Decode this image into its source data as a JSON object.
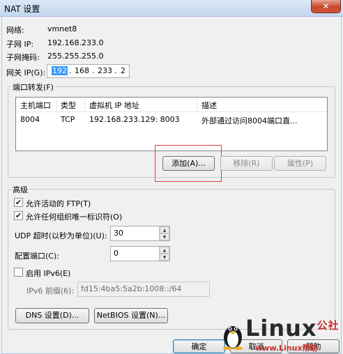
{
  "window": {
    "title": "NAT 设置",
    "close_glyph": "✕"
  },
  "info": {
    "network_label": "网络:",
    "network_value": "vmnet8",
    "subnet_ip_label": "子网 IP:",
    "subnet_ip_value": "192.168.233.0",
    "subnet_mask_label": "子网掩码:",
    "subnet_mask_value": "255.255.255.0",
    "gateway_label": "网关 IP(G):",
    "gateway_octets": [
      "192",
      "168",
      "233",
      "2"
    ]
  },
  "port_forwarding": {
    "group_title": "端口转发(F)",
    "columns": [
      "主机端口",
      "类型",
      "虚拟机 IP 地址",
      "描述"
    ],
    "rows": [
      {
        "host_port": "8004",
        "type": "TCP",
        "vm_ip": "192.168.233.129: 8003",
        "description": "外部通过访问8004端口直..."
      }
    ],
    "add_label": "添加(A)...",
    "remove_label": "移除(R)",
    "properties_label": "属性(P)"
  },
  "advanced": {
    "group_title": "高级",
    "allow_ftp_label": "允许活动的 FTP(T)",
    "allow_ftp_checked": true,
    "allow_oui_label": "允许任何组织唯一标识符(O)",
    "allow_oui_checked": true,
    "udp_timeout_label": "UDP 超时(以秒为单位)(U):",
    "udp_timeout_value": "30",
    "config_port_label": "配置端口(C):",
    "config_port_value": "0",
    "enable_ipv6_label": "启用 IPv6(E)",
    "enable_ipv6_checked": false,
    "ipv6_prefix_label": "IPv6 前缀(6):",
    "ipv6_prefix_value": "fd15:4ba5:5a2b:1008::/64",
    "dns_button_label": "DNS 设置(D)...",
    "netbios_button_label": "NetBIOS 设置(N)..."
  },
  "footer": {
    "ok_label": "确定",
    "cancel_label": "取消",
    "help_label": "帮助"
  },
  "watermark": {
    "brand": "Linux",
    "brand_suffix": "公社",
    "url": "www.Linux帮助"
  },
  "colors": {
    "accent_highlight": "#3399ff",
    "annotation_red": "#e13b3b"
  }
}
